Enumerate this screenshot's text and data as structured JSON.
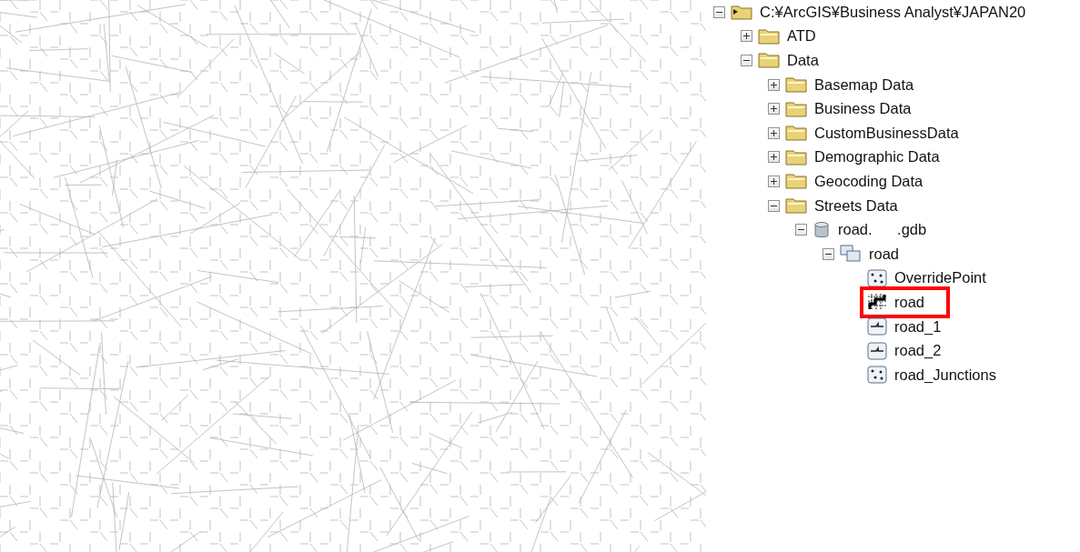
{
  "tree": [
    {
      "label": "C:¥ArcGIS¥Business Analyst¥JAPAN20",
      "kind": "root",
      "expanded": true,
      "highlighted": false,
      "children": [
        {
          "label": "ATD",
          "kind": "folder",
          "expanded": false,
          "highlighted": false
        },
        {
          "label": "Data",
          "kind": "folder",
          "expanded": true,
          "highlighted": false,
          "children": [
            {
              "label": "Basemap Data",
              "kind": "folder",
              "expanded": false,
              "highlighted": false
            },
            {
              "label": "Business Data",
              "kind": "folder",
              "expanded": false,
              "highlighted": false
            },
            {
              "label": "CustomBusinessData",
              "kind": "folder",
              "expanded": false,
              "highlighted": false
            },
            {
              "label": "Demographic Data",
              "kind": "folder",
              "expanded": false,
              "highlighted": false
            },
            {
              "label": "Geocoding Data",
              "kind": "folder",
              "expanded": false,
              "highlighted": false
            },
            {
              "label": "Streets Data",
              "kind": "folder",
              "expanded": true,
              "highlighted": false,
              "children": [
                {
                  "label": "road.      .gdb",
                  "kind": "database",
                  "expanded": true,
                  "highlighted": false,
                  "children": [
                    {
                      "label": "road",
                      "kind": "dataset",
                      "expanded": true,
                      "highlighted": false,
                      "children": [
                        {
                          "label": "OverridePoint",
                          "kind": "point",
                          "highlighted": false
                        },
                        {
                          "label": "road",
                          "kind": "network",
                          "highlighted": true
                        },
                        {
                          "label": "road_1",
                          "kind": "line",
                          "highlighted": false
                        },
                        {
                          "label": "road_2",
                          "kind": "line",
                          "highlighted": false
                        },
                        {
                          "label": "road_Junctions",
                          "kind": "point",
                          "highlighted": false
                        }
                      ]
                    }
                  ]
                }
              ]
            }
          ]
        }
      ]
    }
  ]
}
